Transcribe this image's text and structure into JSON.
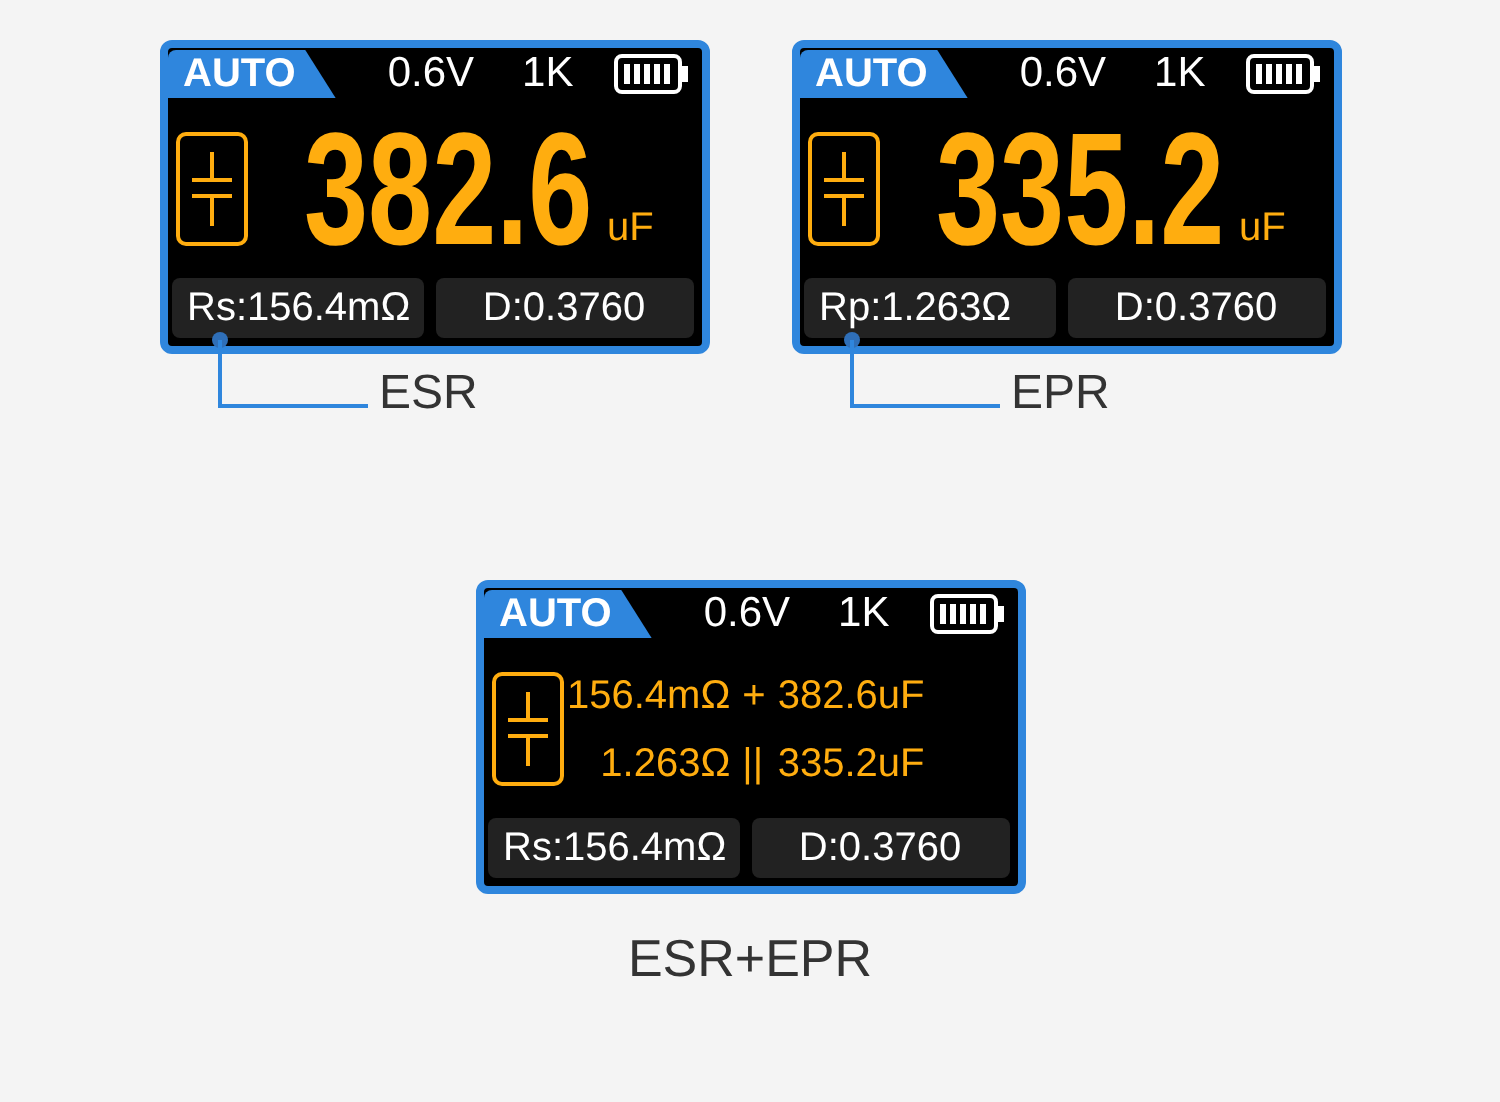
{
  "screens": [
    {
      "mode": "AUTO",
      "voltage": "0.6V",
      "frequency": "1K",
      "display": {
        "kind": "single",
        "value": "382.6",
        "unit": "uF"
      },
      "footer": [
        "Rs:156.4mΩ",
        "D:0.3760"
      ],
      "caption": "ESR",
      "leader": true
    },
    {
      "mode": "AUTO",
      "voltage": "0.6V",
      "frequency": "1K",
      "display": {
        "kind": "single",
        "value": "335.2",
        "unit": "uF"
      },
      "footer": [
        "Rp:1.263Ω",
        "D:0.3760"
      ],
      "caption": "EPR",
      "leader": true
    },
    {
      "mode": "AUTO",
      "voltage": "0.6V",
      "frequency": "1K",
      "display": {
        "kind": "dual",
        "rows": [
          {
            "resistance": "156.4mΩ",
            "link": "+",
            "capacitance": "382.6uF"
          },
          {
            "resistance": "1.263Ω",
            "link": "||",
            "capacitance": "335.2uF"
          }
        ]
      },
      "footer": [
        "Rs:156.4mΩ",
        "D:0.3760"
      ],
      "caption": "ESR+EPR",
      "leader": false
    }
  ]
}
